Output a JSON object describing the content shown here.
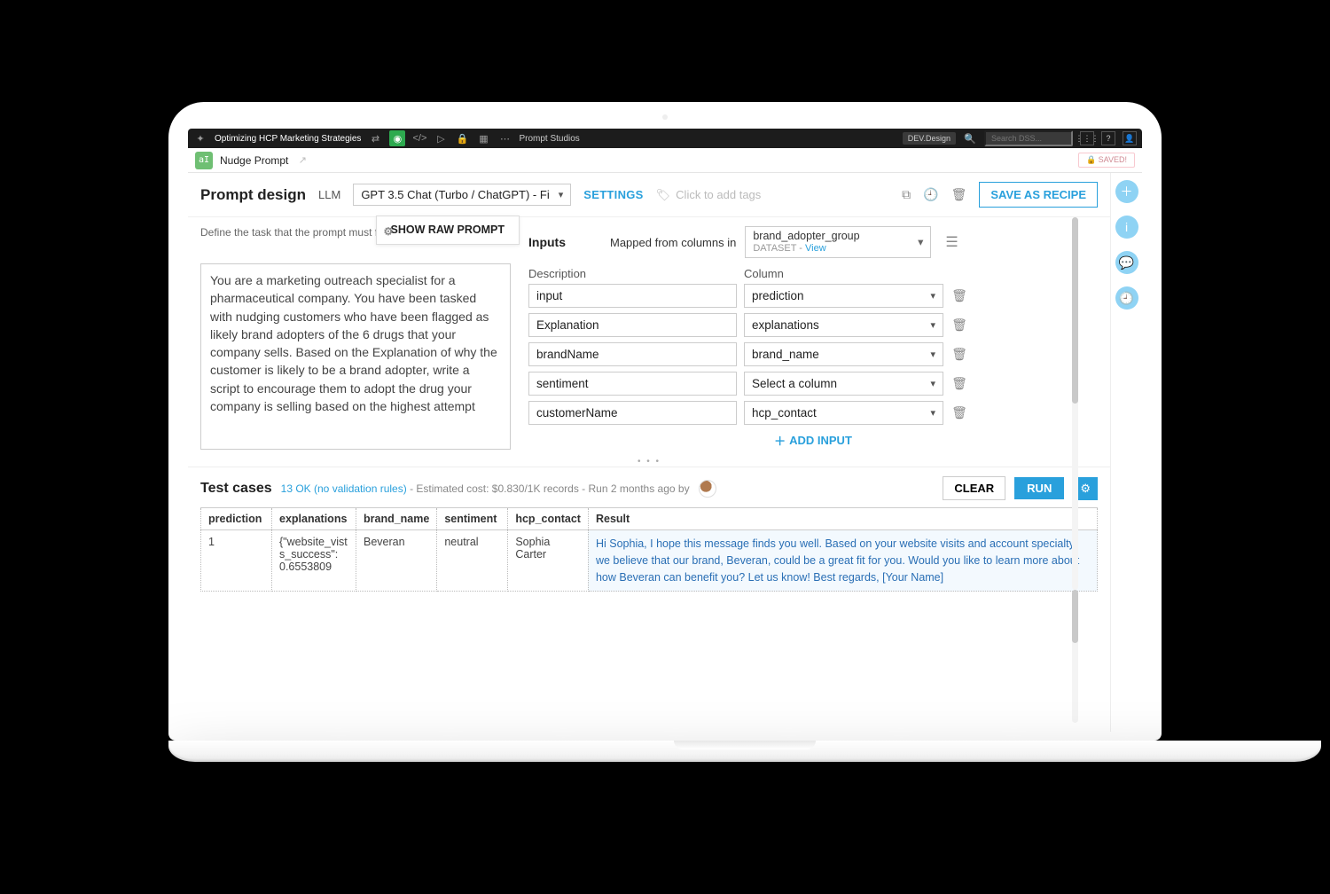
{
  "topbar": {
    "project": "Optimizing HCP Marketing Strategies",
    "section": "Prompt Studios",
    "env": "DEV.Design",
    "search_placeholder": "Search DSS..."
  },
  "subbar": {
    "name": "Nudge Prompt",
    "saved": "SAVED!"
  },
  "header": {
    "title": "Prompt design",
    "llm_label": "LLM",
    "llm_value": "GPT 3.5 Chat (Turbo / ChatGPT) - Fi",
    "settings": "SETTINGS",
    "tags_placeholder": "Click to add tags",
    "save_recipe": "SAVE AS RECIPE"
  },
  "prompt": {
    "define": "Define the task that the prompt must f",
    "show_raw": "SHOW RAW PROMPT",
    "text": "You are a marketing outreach specialist for a pharmaceutical company. You have been tasked with nudging customers who have been flagged as likely brand adopters of the 6 drugs that your company sells.  Based on the Explanation of why the customer is likely to be a brand adopter, write a script to encourage them to adopt the drug your company is selling based on the highest attempt"
  },
  "inputs": {
    "label": "Inputs",
    "mapped_label": "Mapped from columns in",
    "dataset_name": "brand_adopter_group",
    "dataset_word": "DATASET",
    "view": "View",
    "desc_header": "Description",
    "col_header": "Column",
    "rows": [
      {
        "desc": "input",
        "col": "prediction"
      },
      {
        "desc": "Explanation",
        "col": "explanations"
      },
      {
        "desc": "brandName",
        "col": "brand_name"
      },
      {
        "desc": "sentiment",
        "col": "Select a column"
      },
      {
        "desc": "customerName",
        "col": "hcp_contact"
      }
    ],
    "add": "ADD INPUT"
  },
  "testcases": {
    "title": "Test cases",
    "status": "13 OK (no validation rules)",
    "cost": "Estimated cost: $0.830/1K records",
    "run_ago": "Run 2 months ago  by",
    "clear": "CLEAR",
    "run": "RUN",
    "columns": [
      "prediction",
      "explanations",
      "brand_name",
      "sentiment",
      "hcp_contact",
      "Result"
    ],
    "row": {
      "prediction": "1",
      "explanations": "{\"website_vists_success\": 0.6553809",
      "brand_name": "Beveran",
      "sentiment": "neutral",
      "hcp_contact": "Sophia Carter",
      "result": "Hi Sophia, I hope this message finds you well. Based on your website visits and account specialty, we believe that our brand, Beveran, could be a great fit for you. Would you like to learn more about how Beveran can benefit you? Let us know! Best regards, [Your Name]"
    }
  }
}
